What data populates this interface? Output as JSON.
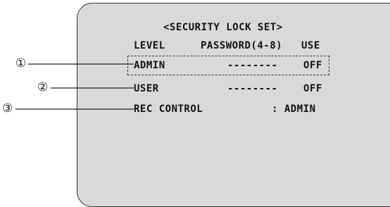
{
  "menu": {
    "title": "<SECURITY LOCK SET>",
    "headers": {
      "level": "LEVEL",
      "password": "PASSWORD(4-8)",
      "use": "USE"
    },
    "rows": [
      {
        "level": "ADMIN",
        "password": "--------",
        "use": "OFF"
      },
      {
        "level": "USER",
        "password": "--------",
        "use": "OFF"
      }
    ],
    "rec_control": {
      "label": "REC CONTROL",
      "value": ": ADMIN"
    }
  },
  "callouts": [
    "①",
    "②",
    "③"
  ]
}
